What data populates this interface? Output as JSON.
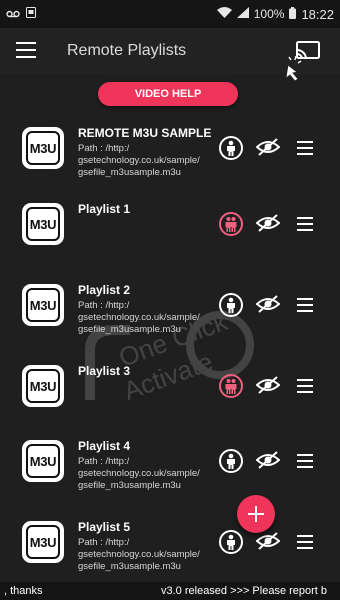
{
  "status_bar": {
    "battery": "100%",
    "time": "18:22"
  },
  "app_bar": {
    "title": "Remote Playlists"
  },
  "video_help_label": "VIDEO HELP",
  "playlists": [
    {
      "badge": "M3U",
      "title": "REMOTE M3U SAMPLE",
      "path": "Path : /http:/ gsetechnology.co.uk/sample/ gsefile_m3usample.m3u",
      "toggle_state": "white"
    },
    {
      "badge": "M3U",
      "title": "Playlist 1",
      "path": "",
      "toggle_state": "pink"
    },
    {
      "badge": "M3U",
      "title": "Playlist 2",
      "path": "Path : /http:/ gsetechnology.co.uk/sample/ gsefile_m3usample.m3u",
      "toggle_state": "white"
    },
    {
      "badge": "M3U",
      "title": "Playlist 3",
      "path": "",
      "toggle_state": "pink"
    },
    {
      "badge": "M3U",
      "title": "Playlist 4",
      "path": "Path : /http:/ gsetechnology.co.uk/sample/ gsefile_m3usample.m3u",
      "toggle_state": "white"
    },
    {
      "badge": "M3U",
      "title": "Playlist 5",
      "path": "Path : /http:/ gsetechnology.co.uk/sample/ gsefile_m3usample.m3u",
      "toggle_state": "white"
    }
  ],
  "watermark": {
    "line1": "One Click",
    "line2": "Activate"
  },
  "ticker": {
    "left": ", thanks",
    "right": "v3.0 released >>>  Please report b"
  },
  "colors": {
    "accent": "#f0355b",
    "background": "#1f1f1f",
    "pink_toggle": "#f0607f"
  },
  "icons": {
    "menu": "hamburger-menu-icon",
    "cast": "cast-icon",
    "person": "person-icon",
    "eye_off": "eye-off-icon",
    "drag": "drag-handle-icon",
    "add": "add-icon"
  }
}
